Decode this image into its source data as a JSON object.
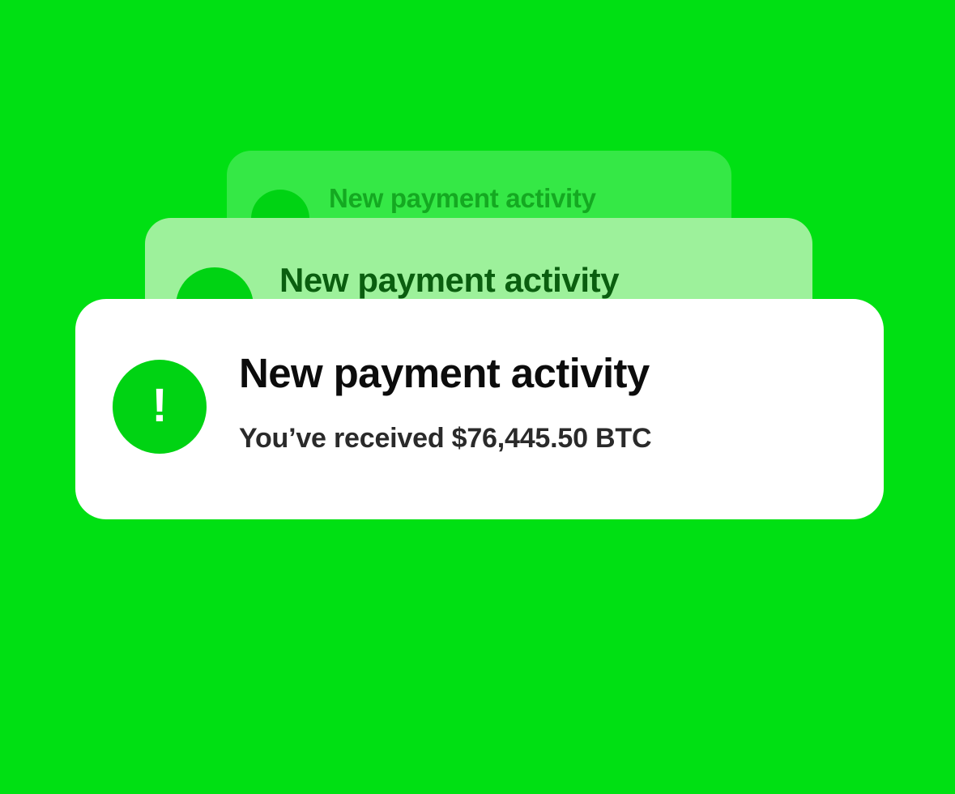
{
  "colors": {
    "background": "#00e013",
    "accent": "#00d313",
    "card_front": "#ffffff",
    "card_mid": "#9df19b",
    "card_back": "#35e846"
  },
  "notifications": [
    {
      "title": "New payment activity",
      "icon": "alert-icon"
    },
    {
      "title": "New payment activity",
      "icon": "alert-icon"
    },
    {
      "title": "New payment activity",
      "message": "You’ve received $76,445.50 BTC",
      "icon": "alert-icon",
      "icon_glyph": "!"
    }
  ]
}
